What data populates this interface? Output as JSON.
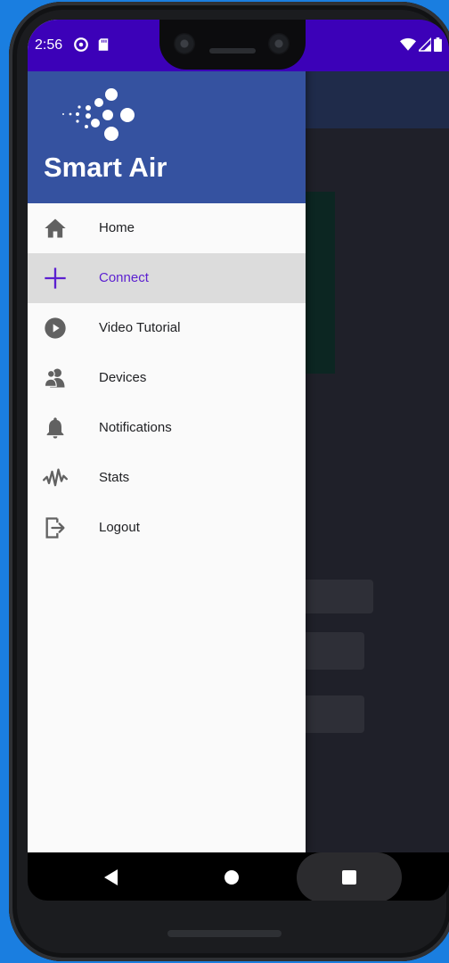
{
  "status_bar": {
    "time": "2:56",
    "color": "#3c01b8",
    "icons": [
      "at-sign-icon",
      "sd-card-icon",
      "wifi-icon",
      "cell-signal-icon",
      "battery-icon"
    ]
  },
  "drawer": {
    "app_name": "Smart Air",
    "header_color": "#3552a0",
    "active_color": "#5b1fd0",
    "items": [
      {
        "label": "Home",
        "icon": "home-icon",
        "active": false
      },
      {
        "label": "Connect",
        "icon": "plus-icon",
        "active": true
      },
      {
        "label": "Video Tutorial",
        "icon": "play-circle-icon",
        "active": false
      },
      {
        "label": "Devices",
        "icon": "users-icon",
        "active": false
      },
      {
        "label": "Notifications",
        "icon": "bell-icon",
        "active": false
      },
      {
        "label": "Stats",
        "icon": "activity-icon",
        "active": false
      },
      {
        "label": "Logout",
        "icon": "logout-icon",
        "active": false
      }
    ]
  },
  "nav_bar": {
    "buttons": [
      "back-button",
      "home-button",
      "recents-button"
    ]
  }
}
